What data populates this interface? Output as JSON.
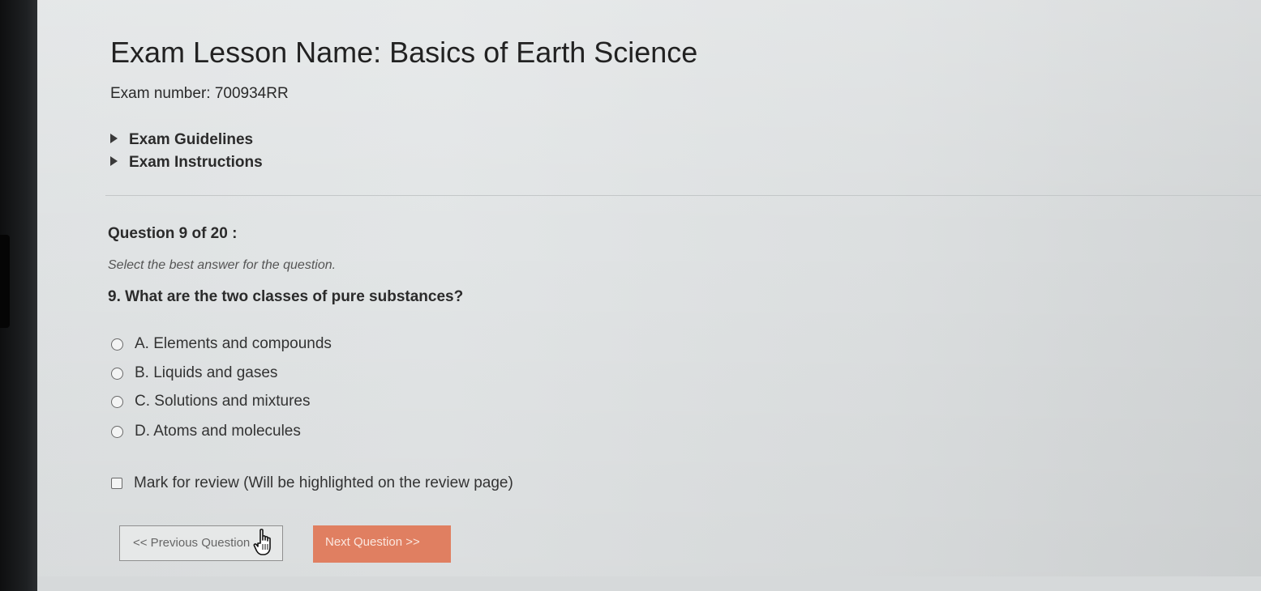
{
  "exam": {
    "title": "Exam Lesson Name: Basics of Earth Science",
    "number_text": "Exam number: 700934RR",
    "sections": [
      {
        "label": "Exam Guidelines"
      },
      {
        "label": "Exam Instructions"
      }
    ]
  },
  "question": {
    "counter": "Question 9 of 20 :",
    "instruction": "Select the best answer for the question.",
    "text": "9.  What are the two classes of pure substances?",
    "options": [
      {
        "label": "A. Elements and compounds",
        "selected": false
      },
      {
        "label": "B. Liquids and gases",
        "selected": false
      },
      {
        "label": "C. Solutions and mixtures",
        "selected": false
      },
      {
        "label": "D. Atoms and molecules",
        "selected": false
      }
    ],
    "review_label": "Mark for review (Will be highlighted on the review page)",
    "review_checked": false
  },
  "navigation": {
    "previous_label": "<< Previous Question",
    "next_label": "Next Question >>"
  },
  "colors": {
    "next_button": "#e07f61",
    "page_background": "#dfe2e3"
  },
  "icons": {
    "section_toggle": "triangle-right-icon",
    "cursor": "hand-pointer-icon"
  }
}
